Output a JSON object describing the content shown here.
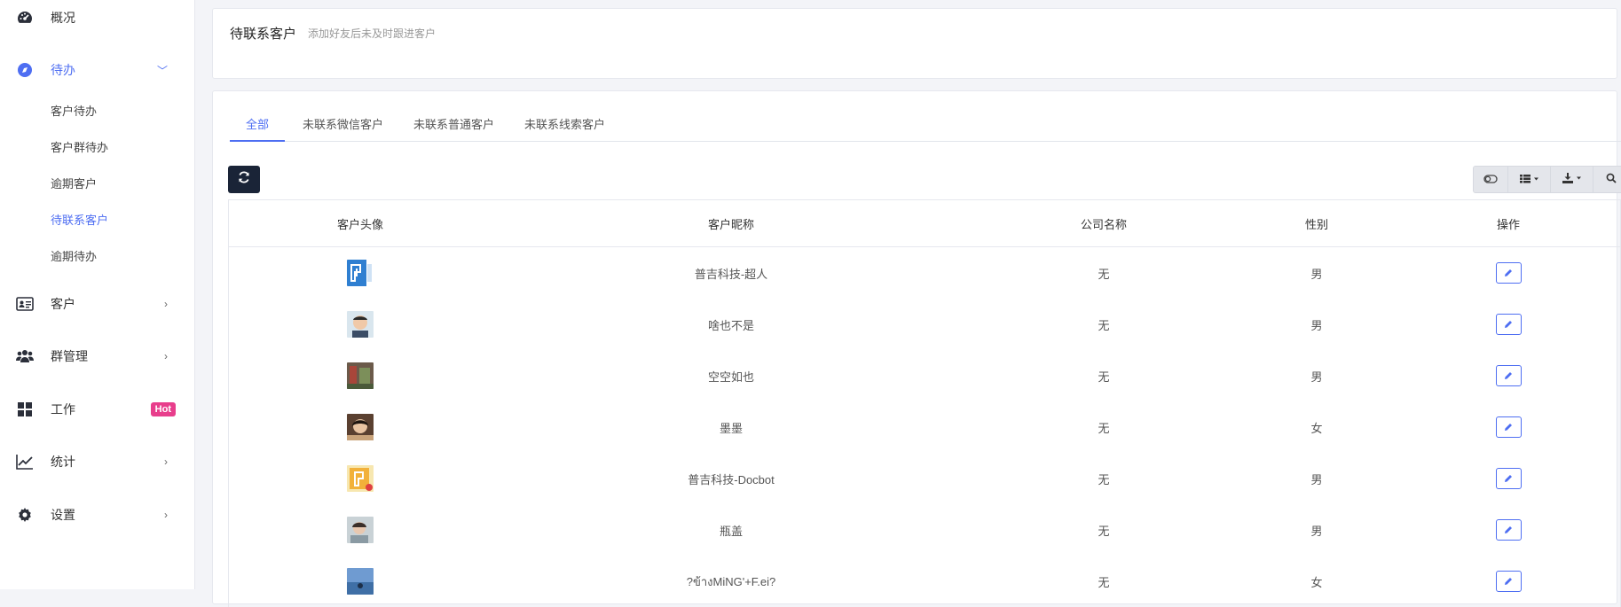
{
  "sidebar": {
    "items": [
      {
        "label": "概况",
        "icon": "dashboard-icon",
        "arrow": ""
      },
      {
        "label": "待办",
        "icon": "compass-icon",
        "arrow": "﹀"
      },
      {
        "label": "客户",
        "icon": "id-card-icon",
        "arrow": "›"
      },
      {
        "label": "群管理",
        "icon": "users-icon",
        "arrow": "›"
      },
      {
        "label": "工作",
        "icon": "grid-icon",
        "badge": "Hot"
      },
      {
        "label": "统计",
        "icon": "chart-line-icon",
        "arrow": "›"
      },
      {
        "label": "设置",
        "icon": "gear-icon",
        "arrow": "›"
      }
    ],
    "sub_items": [
      "客户待办",
      "客户群待办",
      "逾期客户",
      "待联系客户",
      "逾期待办"
    ],
    "active_sub": "待联系客户"
  },
  "header": {
    "title": "待联系客户",
    "subtitle": "添加好友后未及时跟进客户"
  },
  "tabs": [
    "全部",
    "未联系微信客户",
    "未联系普通客户",
    "未联系线索客户"
  ],
  "active_tab": "全部",
  "table": {
    "columns": [
      "客户头像",
      "客户昵称",
      "公司名称",
      "性别",
      "操作"
    ],
    "rows": [
      {
        "nickname": "普吉科技-超人",
        "company": "无",
        "gender": "男"
      },
      {
        "nickname": "啥也不是",
        "company": "无",
        "gender": "男"
      },
      {
        "nickname": "空空如也",
        "company": "无",
        "gender": "男"
      },
      {
        "nickname": "墨墨",
        "company": "无",
        "gender": "女"
      },
      {
        "nickname": "普吉科技-Docbot",
        "company": "无",
        "gender": "男"
      },
      {
        "nickname": "瓶盖",
        "company": "无",
        "gender": "男"
      },
      {
        "nickname": "?ข้างMiNG'+F.ei?",
        "company": "无",
        "gender": "女"
      }
    ]
  },
  "colors": {
    "accent": "#4e6ef2",
    "dark_button": "#1a2437",
    "hot_badge": "#e83e8c"
  }
}
